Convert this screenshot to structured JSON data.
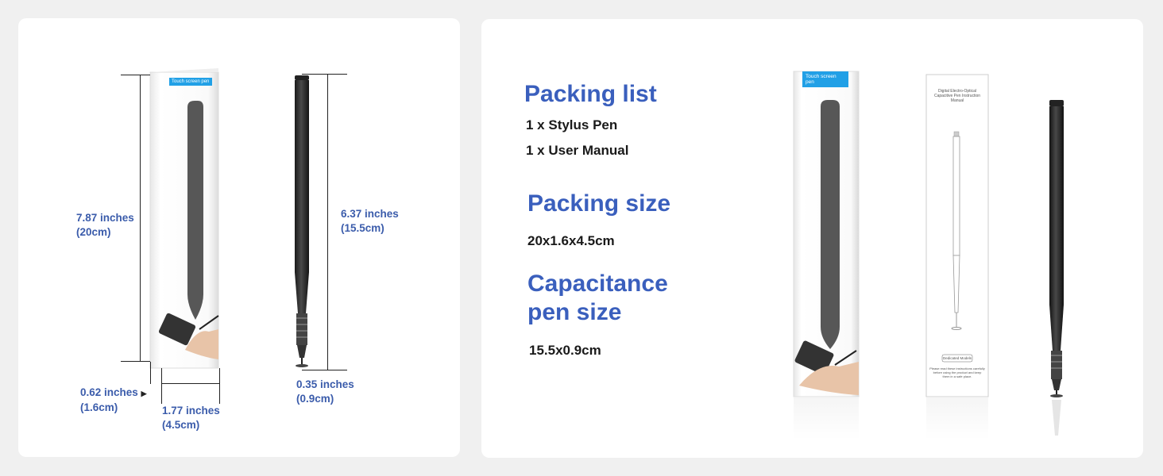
{
  "left": {
    "box_label": "Touch screen pen",
    "box_height": {
      "inches": "7.87 inches",
      "cm": "(20cm)"
    },
    "box_depth": {
      "inches": "0.62 inches",
      "cm": "(1.6cm)"
    },
    "box_width": {
      "inches": "1.77 inches",
      "cm": "(4.5cm)"
    },
    "pen_length": {
      "inches": "6.37 inches",
      "cm": "(15.5cm)"
    },
    "pen_diameter": {
      "inches": "0.35 inches",
      "cm": "(0.9cm)"
    }
  },
  "right": {
    "packing_list_title": "Packing list",
    "packing_items": [
      "1 x Stylus Pen",
      "1 x User Manual"
    ],
    "packing_size_title": "Packing size",
    "packing_size_value": "20x1.6x4.5cm",
    "pen_size_title_line1": "Capacitance",
    "pen_size_title_line2": "pen size",
    "pen_size_value": "15.5x0.9cm",
    "box_label": "Touch screen pen",
    "manual_title": "Digital Electro-Optical Capacitive Pen Instruction Manual",
    "manual_badge": "Dedicated Models",
    "manual_note": "Please read these instructions carefully before using the product and keep them in a safe place."
  },
  "colors": {
    "accent_blue": "#3a5fbd",
    "label_blue": "#21a0e6",
    "pen_black": "#2a2a2a"
  }
}
